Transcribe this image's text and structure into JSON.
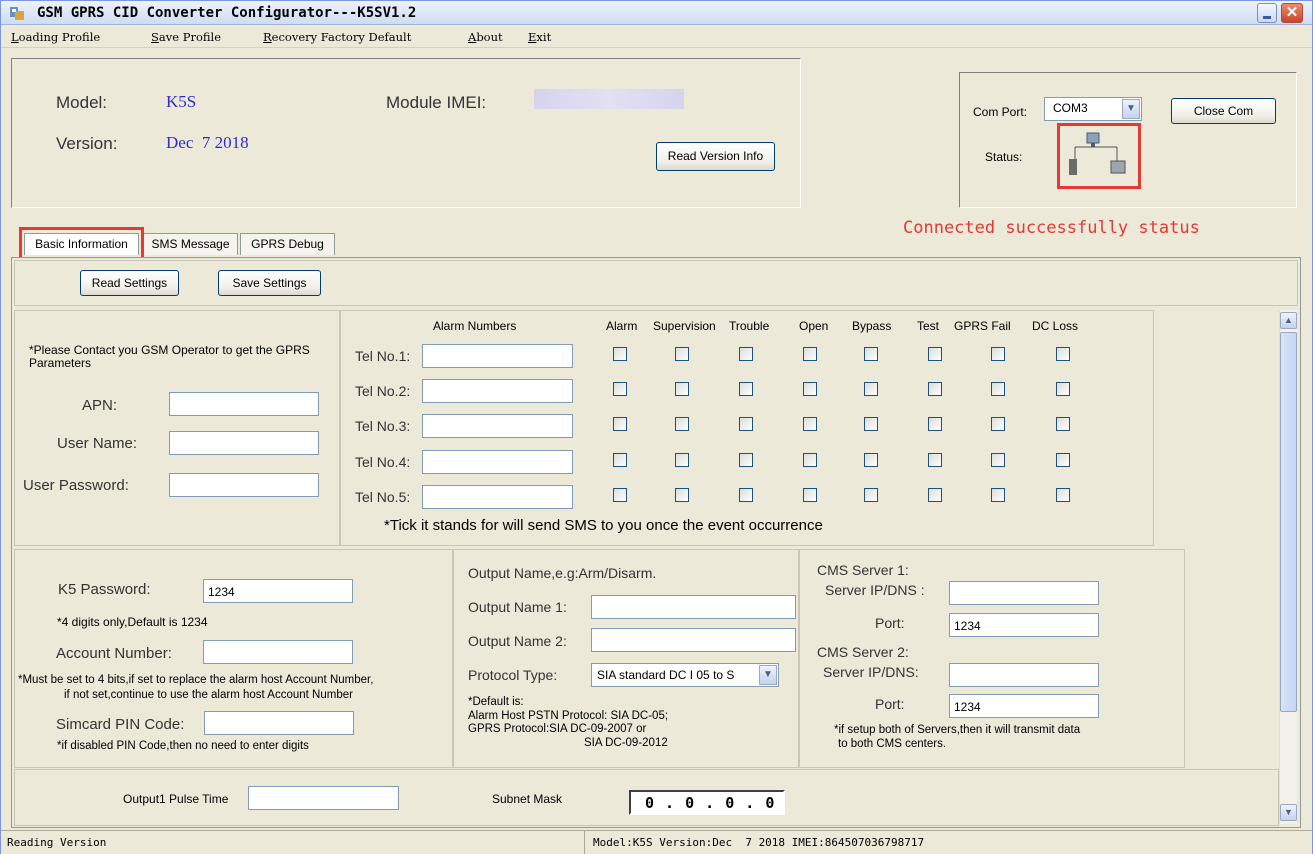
{
  "window": {
    "title": "GSM GPRS CID Converter Configurator---K5SV1.2"
  },
  "menu": [
    "Loading Profile",
    "Save Profile",
    "Recovery Factory Default",
    "About",
    "Exit"
  ],
  "device": {
    "model_label": "Model:",
    "model_value": "K5S",
    "version_label": "Version:",
    "version_value": "Dec  7 2018",
    "imei_label": "Module IMEI:",
    "read_version_button": "Read Version Info"
  },
  "com": {
    "port_label": "Com Port:",
    "port_value": "COM3",
    "close_button": "Close Com",
    "status_label": "Status:",
    "annotation": "Connected successfully status"
  },
  "tabs": [
    "Basic Information",
    "SMS Message",
    "GPRS Debug"
  ],
  "actions": {
    "read": "Read Settings",
    "save": "Save Settings"
  },
  "gprs": {
    "note": "*Please Contact you GSM Operator to get the GPRS Parameters",
    "apn_label": "APN:",
    "user_label": "User Name:",
    "password_label": "User Password:"
  },
  "alarm": {
    "header": "Alarm Numbers",
    "columns": [
      "Alarm",
      "Supervision",
      "Trouble",
      "Open",
      "Bypass",
      "Test",
      "GPRS Fail",
      "DC Loss"
    ],
    "rows": [
      "Tel No.1:",
      "Tel No.2:",
      "Tel No.3:",
      "Tel No.4:",
      "Tel No.5:"
    ],
    "note": "*Tick it stands for will send SMS to you once the event occurrence"
  },
  "k5": {
    "password_label": "K5 Password:",
    "password_value": "1234",
    "password_note": "*4 digits only,Default is 1234",
    "account_label": "Account Number:",
    "account_note1": "*Must be set to 4 bits,if set to replace the alarm host Account Number,",
    "account_note2": "if not set,continue to use the alarm host Account Number",
    "pin_label": "Simcard PIN Code:",
    "pin_note": "*if disabled PIN Code,then no need to enter digits"
  },
  "output": {
    "header": "Output Name,e.g:Arm/Disarm.",
    "name1_label": "Output Name 1:",
    "name2_label": "Output Name 2:",
    "protocol_label": "Protocol Type:",
    "protocol_value": "SIA standard DC I 05 to S",
    "note1": "*Default is:",
    "note2": "Alarm Host PSTN Protocol: SIA DC-05;",
    "note3": "GPRS Protocol:SIA DC-09-2007 or",
    "note4": "SIA DC-09-2012"
  },
  "cms": {
    "server1_label": "CMS Server 1:",
    "ip1_label": "Server IP/DNS :",
    "port1_label": "Port:",
    "port1_value": "1234",
    "server2_label": "CMS Server 2:",
    "ip2_label": "Server IP/DNS:",
    "port2_label": "Port:",
    "port2_value": "1234",
    "note1": "*if setup both of Servers,then it will transmit data",
    "note2": "to both CMS centers."
  },
  "bottom": {
    "pulse_label": "Output1 Pulse Time",
    "subnet_label": "Subnet Mask",
    "subnet_value": "0 . 0 . 0 . 0"
  },
  "status": {
    "left": "Reading Version",
    "right": "Model:K5S Version:Dec  7 2018 IMEI:864507036798717"
  },
  "colors": {
    "accent_blue": "#2b2bd6",
    "annotation_red": "#e53935",
    "titlebar": "#cfdcf1"
  }
}
